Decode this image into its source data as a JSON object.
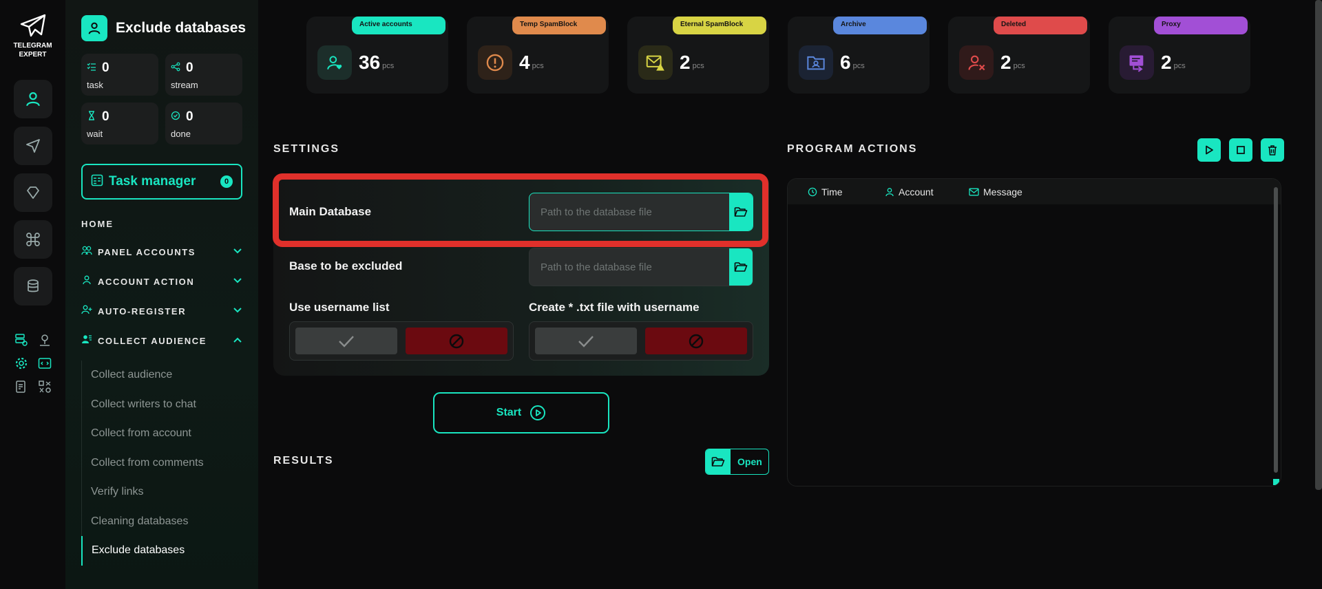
{
  "brand": {
    "name": "TELEGRAM EXPERT"
  },
  "sidebar": {
    "title": "Exclude databases",
    "stats": [
      {
        "icon": "list-check-icon",
        "value": "0",
        "label": "task"
      },
      {
        "icon": "share-icon",
        "value": "0",
        "label": "stream"
      },
      {
        "icon": "hourglass-icon",
        "value": "0",
        "label": "wait"
      },
      {
        "icon": "check-circle-icon",
        "value": "0",
        "label": "done"
      }
    ],
    "task_manager": {
      "label": "Task manager",
      "count": "0"
    },
    "home_label": "HOME",
    "sections": [
      {
        "label": "PANEL ACCOUNTS",
        "icon": "users-icon",
        "expanded": false
      },
      {
        "label": "ACCOUNT ACTION",
        "icon": "user-icon",
        "expanded": false
      },
      {
        "label": "AUTO-REGISTER",
        "icon": "user-plus-icon",
        "expanded": false
      },
      {
        "label": "COLLECT AUDIENCE",
        "icon": "user-group-icon",
        "expanded": true
      }
    ],
    "subitems": [
      "Collect audience",
      "Collect writers to chat",
      "Collect from account",
      "Collect from comments",
      "Verify links",
      "Cleaning databases",
      "Exclude databases"
    ],
    "active_subitem": "Exclude databases"
  },
  "cards": [
    {
      "label": "Active accounts",
      "value": "36",
      "unit": "pcs",
      "color": "#19e6c1",
      "icon": "user-heart-icon"
    },
    {
      "label": "Temp SpamBlock",
      "value": "4",
      "unit": "pcs",
      "color": "#e08a4c",
      "icon": "alert-circle-icon"
    },
    {
      "label": "Eternal SpamBlock",
      "value": "2",
      "unit": "pcs",
      "color": "#d8d444",
      "icon": "mail-warning-icon"
    },
    {
      "label": "Archive",
      "value": "6",
      "unit": "pcs",
      "color": "#5a87dd",
      "icon": "folder-user-icon"
    },
    {
      "label": "Deleted",
      "value": "2",
      "unit": "pcs",
      "color": "#df4b4b",
      "icon": "user-x-icon"
    },
    {
      "label": "Proxy",
      "value": "2",
      "unit": "pcs",
      "color": "#a24fd6",
      "icon": "proxy-icon"
    }
  ],
  "settings": {
    "title": "SETTINGS",
    "main_db": {
      "label": "Main Database",
      "placeholder": "Path to the database file",
      "value": ""
    },
    "exclude_db": {
      "label": "Base to be excluded",
      "placeholder": "Path to the database file",
      "value": ""
    },
    "use_username": {
      "label": "Use username list"
    },
    "create_txt": {
      "label": "Create * .txt file with username"
    },
    "start_label": "Start"
  },
  "results": {
    "title": "RESULTS",
    "open_label": "Open"
  },
  "program_actions": {
    "title": "PROGRAM ACTIONS",
    "columns": [
      "Time",
      "Account",
      "Message"
    ]
  },
  "colors": {
    "accent": "#19e6c1",
    "highlight": "#e0302b",
    "deny": "#6b0a10"
  }
}
